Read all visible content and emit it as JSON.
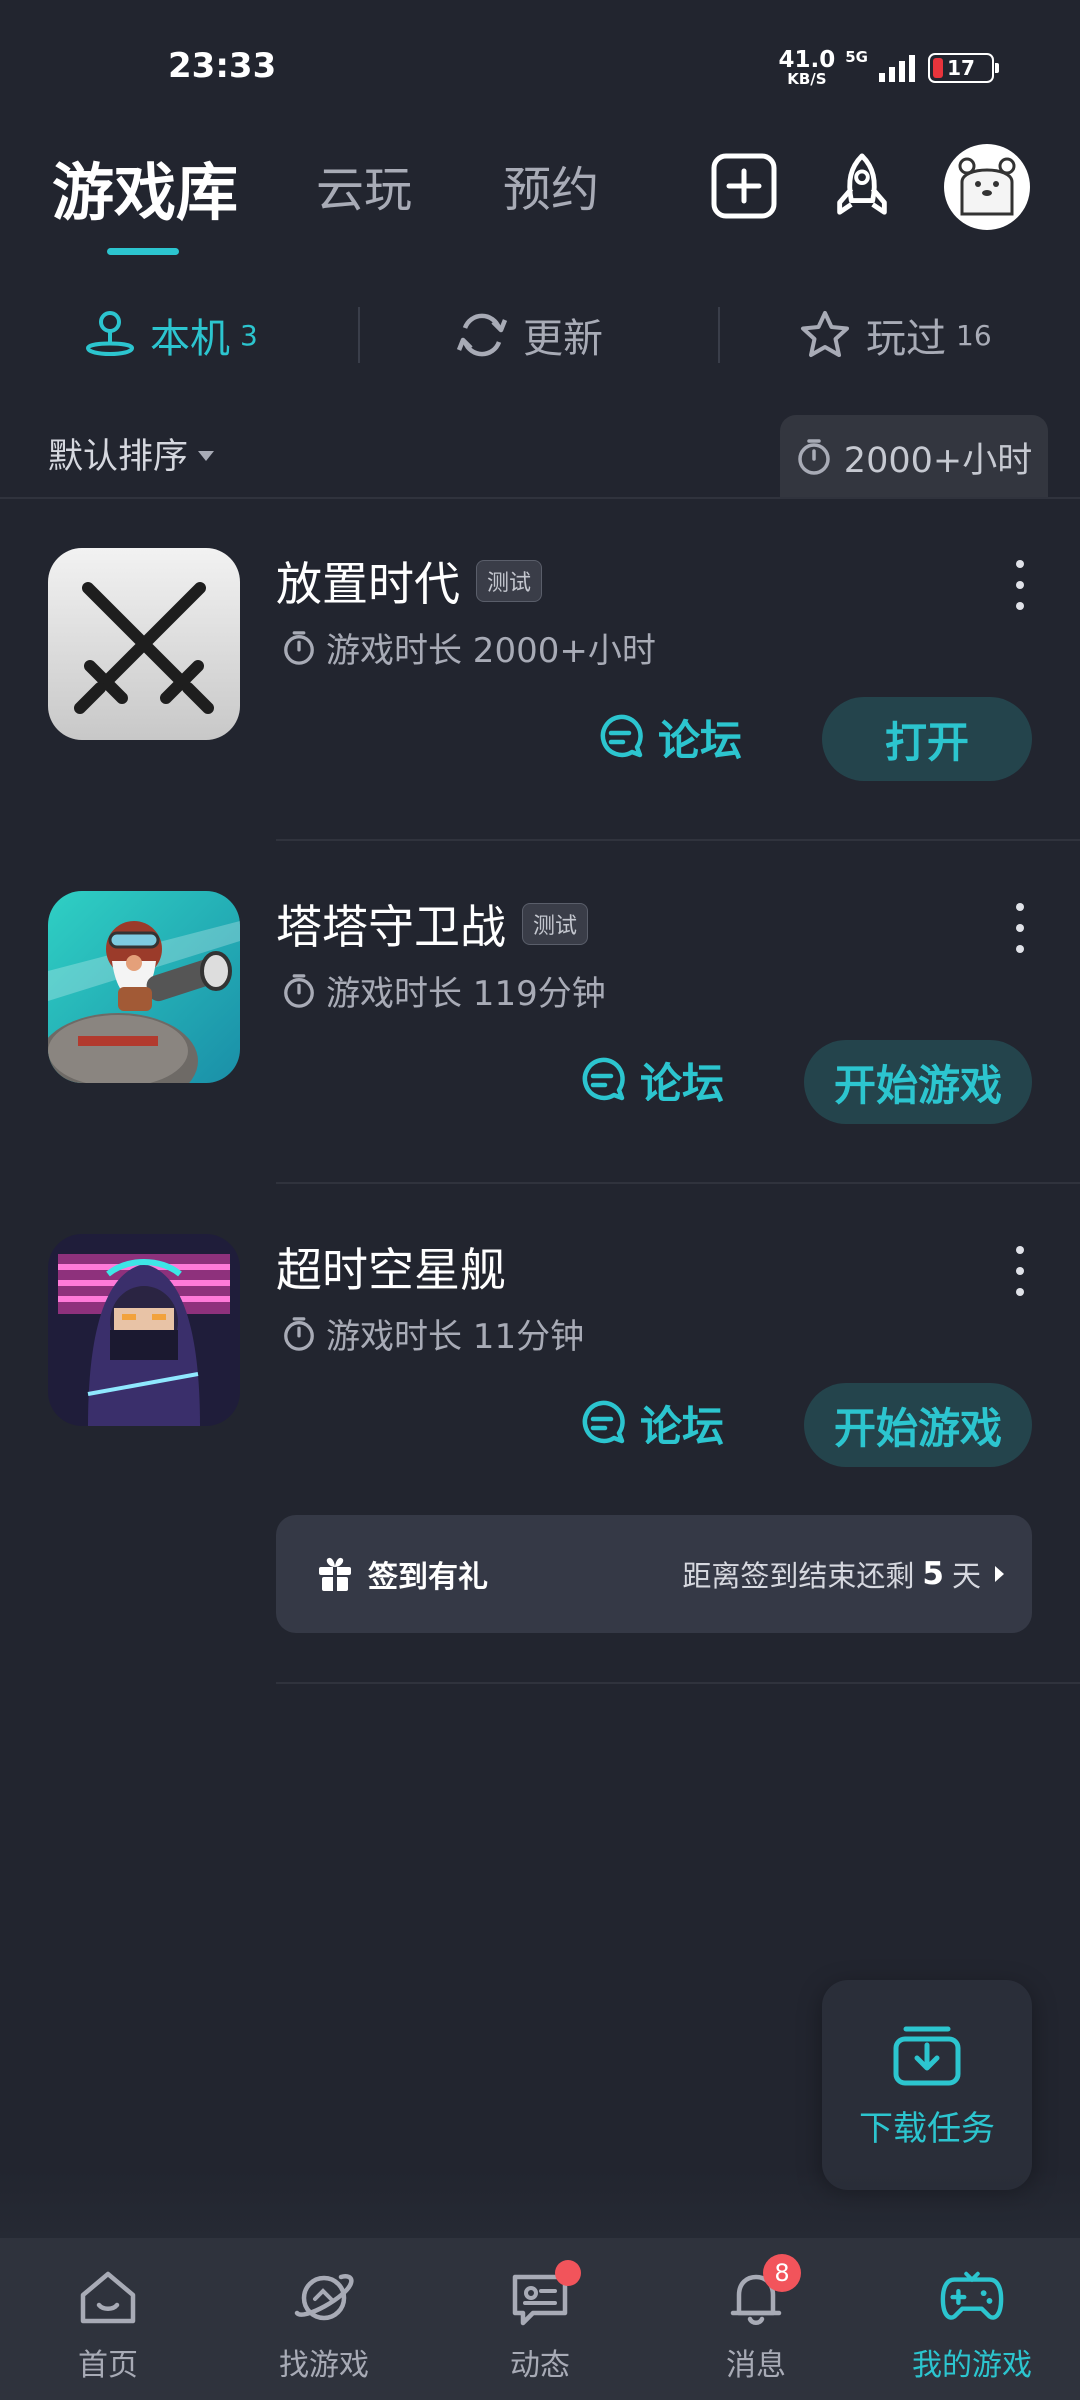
{
  "status_bar": {
    "time": "23:33",
    "net_speed_value": "41.0",
    "net_speed_unit": "KB/S",
    "network_type": "5G",
    "battery_level": "17"
  },
  "header": {
    "tabs": [
      {
        "label": "游戏库",
        "active": true
      },
      {
        "label": "云玩",
        "active": false
      },
      {
        "label": "预约",
        "active": false
      }
    ]
  },
  "sub_tabs": [
    {
      "label": "本机",
      "count": "3",
      "active": true
    },
    {
      "label": "更新",
      "count": "",
      "active": false
    },
    {
      "label": "玩过",
      "count": "16",
      "active": false
    }
  ],
  "sort": {
    "label": "默认排序",
    "total_time": "2000+小时"
  },
  "games": [
    {
      "name": "放置时代",
      "badge": "测试",
      "play_time": "游戏时长 2000+小时",
      "forum_label": "论坛",
      "action_label": "打开"
    },
    {
      "name": "塔塔守卫战",
      "badge": "测试",
      "play_time": "游戏时长 119分钟",
      "forum_label": "论坛",
      "action_label": "开始游戏"
    },
    {
      "name": "超时空星舰",
      "badge": "",
      "play_time": "游戏时长 11分钟",
      "forum_label": "论坛",
      "action_label": "开始游戏"
    }
  ],
  "checkin": {
    "title": "签到有礼",
    "remaining_prefix": "距离签到结束还剩",
    "remaining_days": "5",
    "remaining_suffix": "天"
  },
  "download_task": {
    "label": "下载任务"
  },
  "bottom_nav": [
    {
      "label": "首页",
      "icon": "home-icon",
      "active": false
    },
    {
      "label": "找游戏",
      "icon": "planet-icon",
      "active": false
    },
    {
      "label": "动态",
      "icon": "chat-icon",
      "active": false,
      "dot": true
    },
    {
      "label": "消息",
      "icon": "bell-icon",
      "active": false,
      "badge": "8"
    },
    {
      "label": "我的游戏",
      "icon": "gamepad-icon",
      "active": true
    }
  ],
  "colors": {
    "background": "#22252f",
    "accent": "#2cc5cf",
    "badge_red": "#f2545b"
  }
}
